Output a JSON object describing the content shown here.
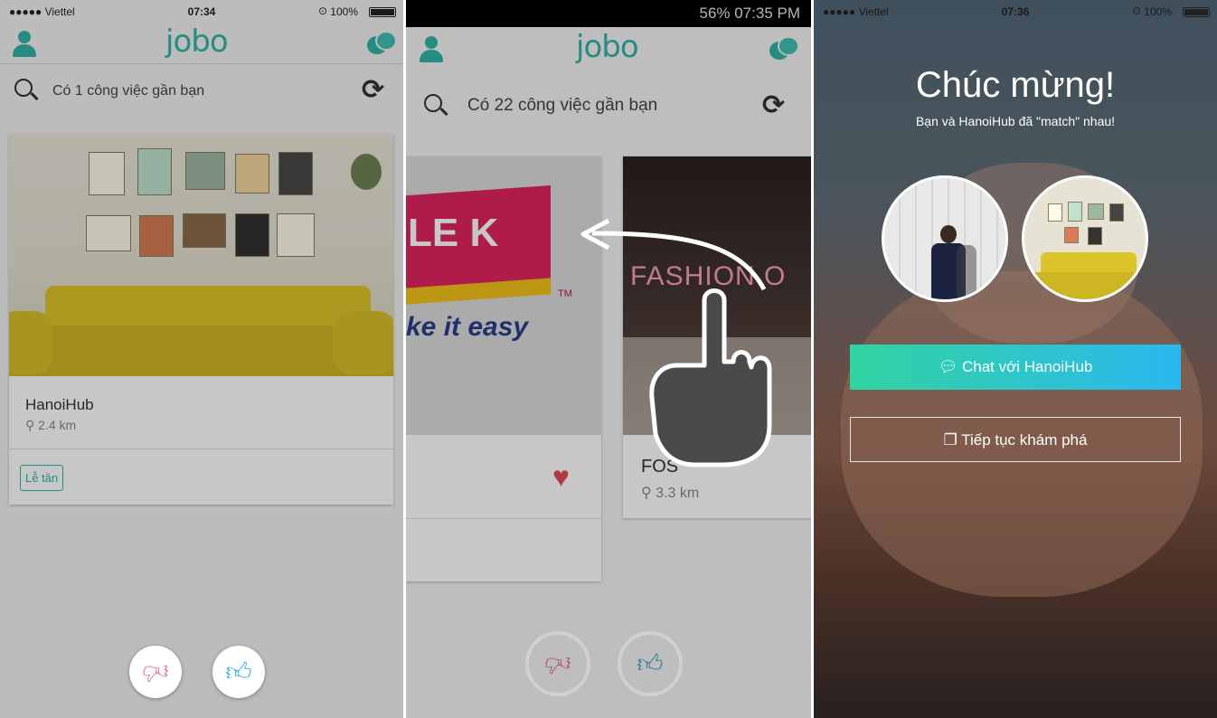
{
  "colors": {
    "accent": "#2fb4a5",
    "dislike": "#e07aa5",
    "like": "#3ab0e0",
    "heart": "#e24b55"
  },
  "panel1": {
    "status": {
      "carrier": "●●●●● Viettel",
      "time": "07:34",
      "battery": "100%"
    },
    "logo": "jobo",
    "search_text": "Có 1 công việc gần bạn",
    "card": {
      "company": "HanoiHub",
      "distance": "2.4 km",
      "tag": "Lễ tân"
    },
    "dislike_icon": "thumbs-down-icon",
    "like_icon": "thumbs-up-icon"
  },
  "panel2": {
    "status": {
      "right": "56% 07:35 PM"
    },
    "logo": "jobo",
    "search_text": "Có 22 công việc gần bạn",
    "card_left": {
      "brand_text": "LE K",
      "tm": "TM",
      "slogan": "ke it easy"
    },
    "card_right": {
      "company": "FOS",
      "distance": "3.3 km",
      "sign_text": "FASHION O"
    }
  },
  "panel3": {
    "status": {
      "carrier": "●●●●● Viettel",
      "time": "07:36",
      "battery": "100%"
    },
    "title": "Chúc mừng!",
    "subtitle": "Bạn và HanoiHub đã \"match\" nhau!",
    "chat_button": "Chat với HanoiHub",
    "explore_button": "Tiếp tục khám phá"
  }
}
